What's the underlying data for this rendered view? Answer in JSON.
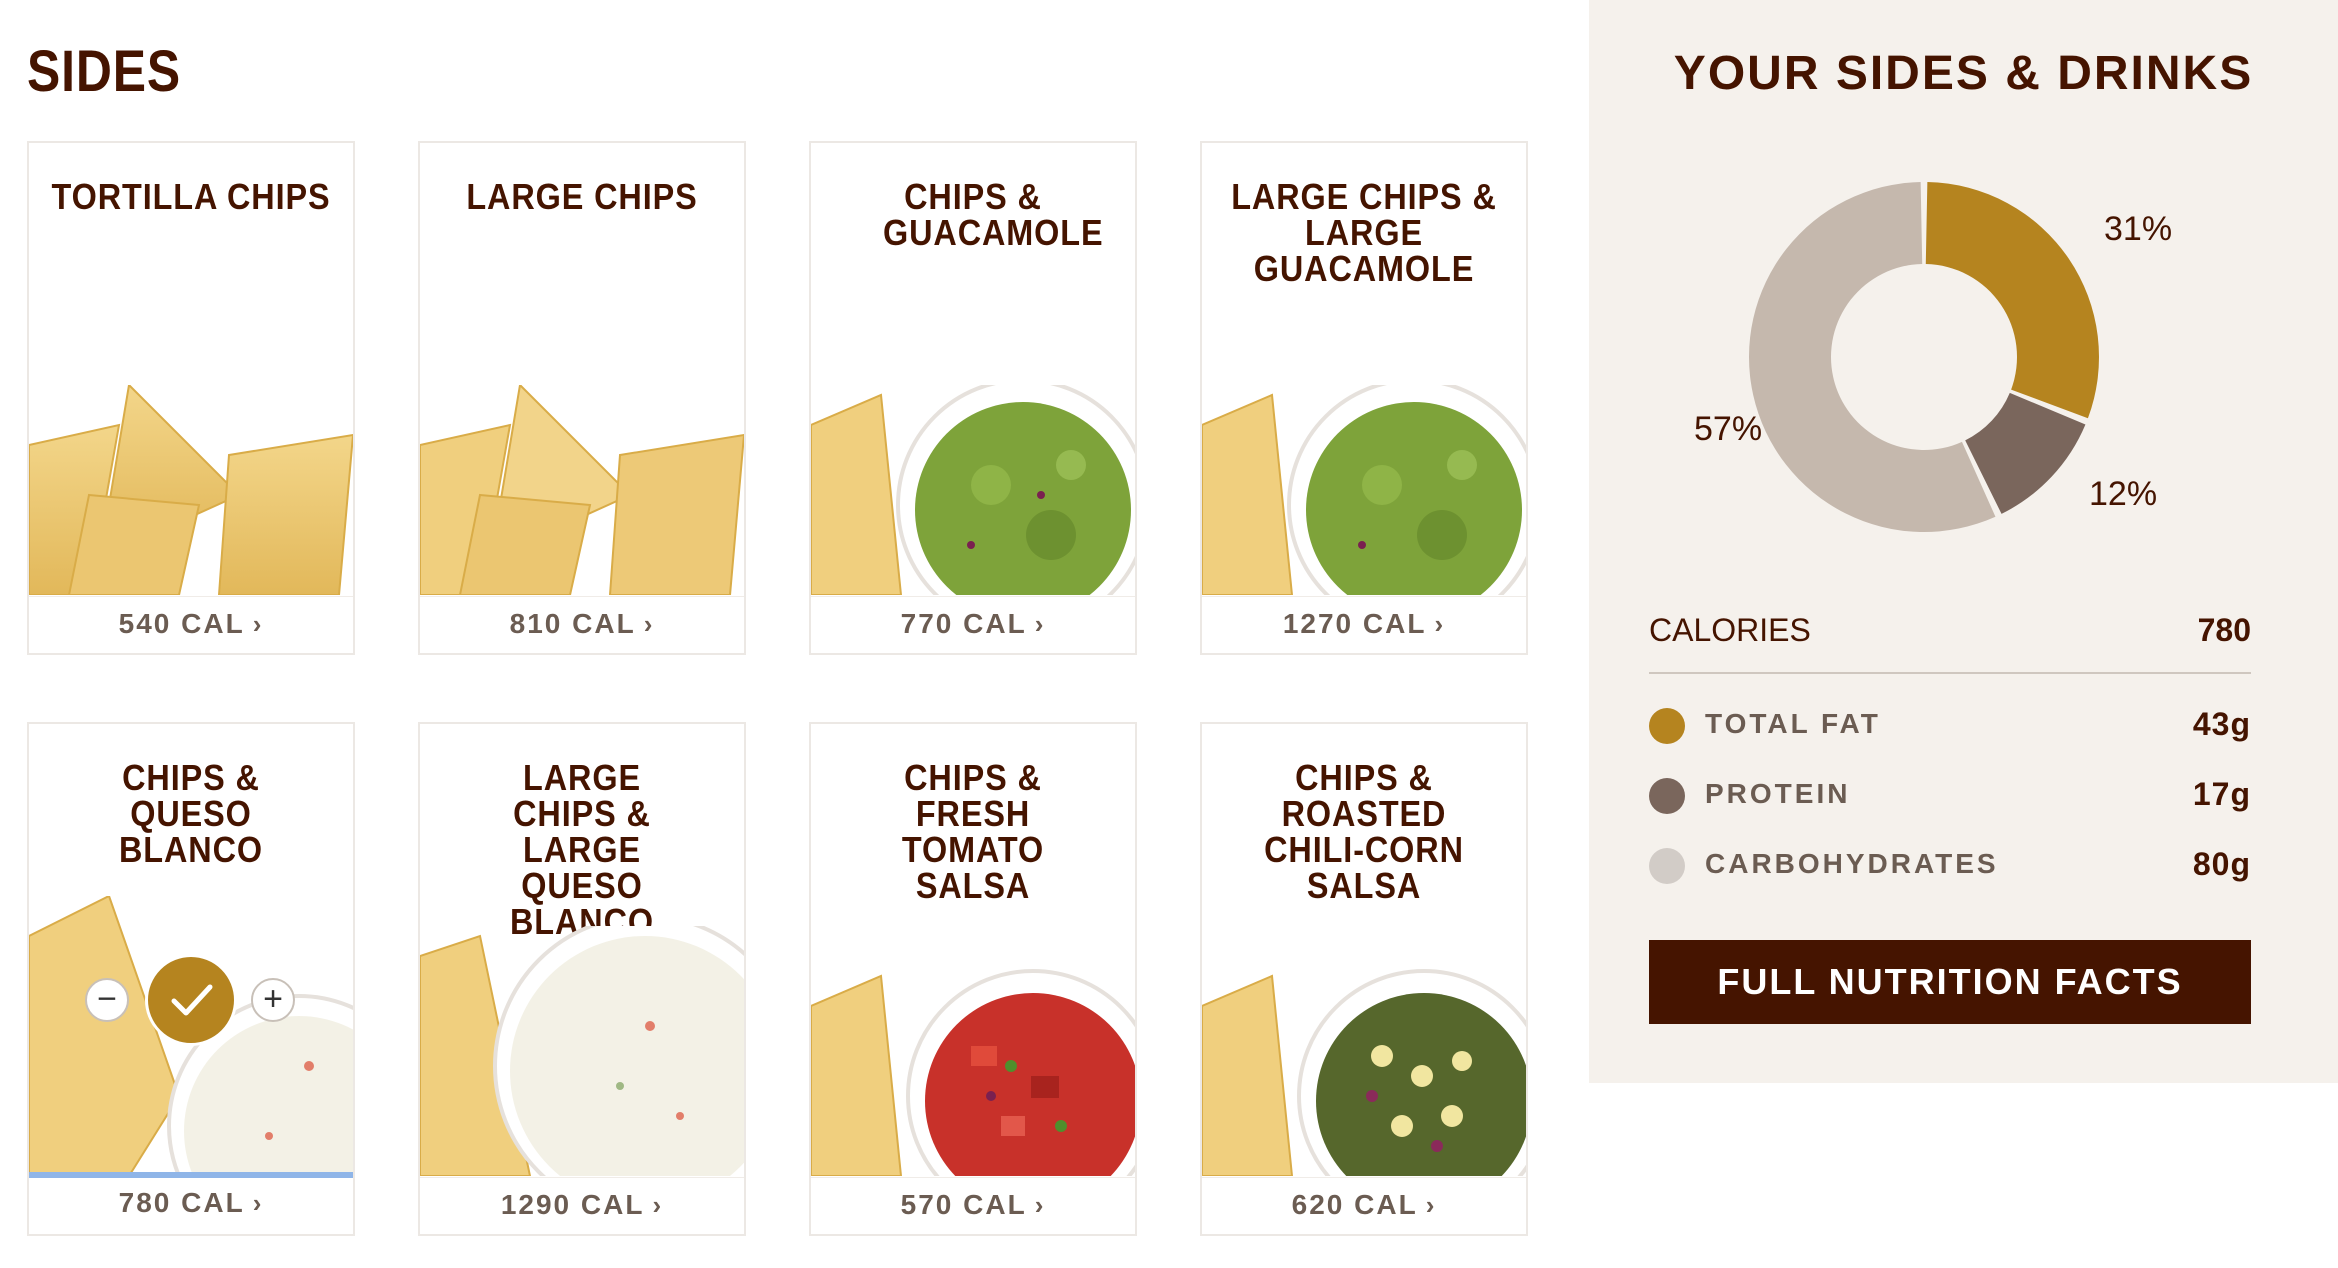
{
  "page": {
    "section_title": "SIDES"
  },
  "cards": [
    {
      "title": "TORTILLA CHIPS",
      "calories": "540 CAL",
      "image": "chips"
    },
    {
      "title": "LARGE CHIPS",
      "calories": "810 CAL",
      "image": "chips"
    },
    {
      "title": "CHIPS & GUACAMOLE",
      "calories": "770 CAL",
      "image": "guacamole"
    },
    {
      "title": "LARGE CHIPS & LARGE GUACAMOLE",
      "calories": "1270 CAL",
      "image": "guacamole"
    },
    {
      "title": "CHIPS & QUESO BLANCO",
      "calories": "780 CAL",
      "image": "queso",
      "selected": true
    },
    {
      "title": "LARGE CHIPS & LARGE QUESO BLANCO",
      "calories": "1290 CAL",
      "image": "queso-large"
    },
    {
      "title": "CHIPS & FRESH TOMATO SALSA",
      "calories": "570 CAL",
      "image": "tomato-salsa"
    },
    {
      "title": "CHIPS & ROASTED CHILI-CORN SALSA",
      "calories": "620 CAL",
      "image": "corn-salsa"
    }
  ],
  "panel": {
    "title": "YOUR SIDES & DRINKS",
    "calories_label": "CALORIES",
    "calories_value": "780",
    "nutrients": [
      {
        "label": "TOTAL FAT",
        "value": "43g",
        "color": "#b5841f"
      },
      {
        "label": "PROTEIN",
        "value": "17g",
        "color": "#7a665c"
      },
      {
        "label": "CARBOHYDRATES",
        "value": "80g",
        "color": "#d2ccc7"
      }
    ],
    "button_label": "FULL NUTRITION FACTS"
  },
  "chart_data": {
    "type": "pie",
    "categories": [
      "TOTAL FAT",
      "PROTEIN",
      "CARBOHYDRATES"
    ],
    "values": [
      31,
      12,
      57
    ],
    "labels": [
      "31%",
      "12%",
      "57%"
    ],
    "colors": [
      "#b5841f",
      "#7a665c",
      "#c5b8ad"
    ]
  },
  "colors": {
    "brand": "#451400",
    "accent": "#b5841f",
    "panel_bg": "#f5f1ec"
  }
}
